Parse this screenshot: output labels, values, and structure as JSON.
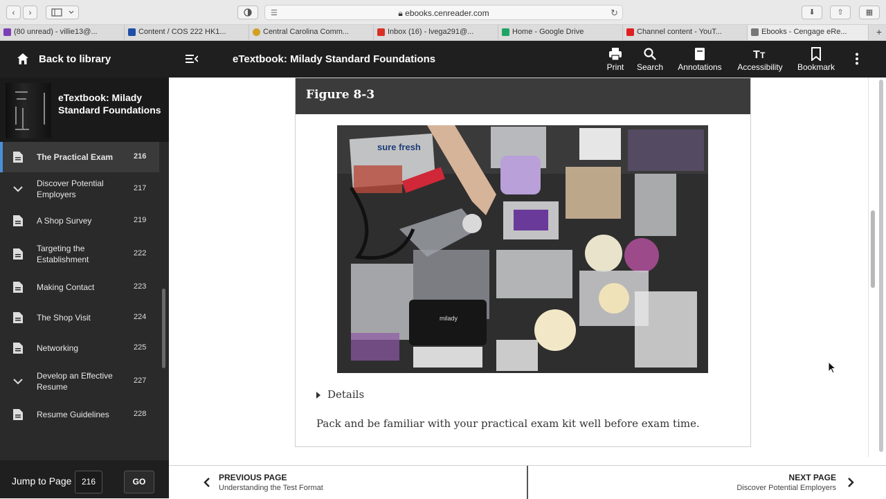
{
  "browser": {
    "url": "ebooks.cenreader.com",
    "tabs": [
      {
        "label": "(80 unread) - villie13@...",
        "color": "#7b3fb5"
      },
      {
        "label": "Content / COS 222 HK1...",
        "color": "#1f4fa8"
      },
      {
        "label": "Central Carolina Comm...",
        "color": "#d0a020"
      },
      {
        "label": "Inbox (16) - lvega291@...",
        "color": "#d93025"
      },
      {
        "label": "Home - Google Drive",
        "color": "#1fa463"
      },
      {
        "label": "Channel content - YouT...",
        "color": "#e02020"
      },
      {
        "label": "Ebooks - Cengage eRe...",
        "color": "#777777"
      }
    ]
  },
  "header": {
    "back_label": "Back to library",
    "title": "eTextbook: Milady Standard Foundations",
    "tools": {
      "print": "Print",
      "search": "Search",
      "annotations": "Annotations",
      "accessibility": "Accessibility",
      "bookmark": "Bookmark"
    }
  },
  "sidebar": {
    "book_title": "eTextbook: Milady Standard Foundations",
    "items": [
      {
        "label": "The Practical Exam",
        "page": "216",
        "icon": "document-icon",
        "active": true
      },
      {
        "label": "Discover Potential Employers",
        "page": "217",
        "icon": "chevron-down-icon",
        "active": false
      },
      {
        "label": "A Shop Survey",
        "page": "219",
        "icon": "document-icon",
        "active": false
      },
      {
        "label": "Targeting the Establishment",
        "page": "222",
        "icon": "document-icon",
        "active": false
      },
      {
        "label": "Making Contact",
        "page": "223",
        "icon": "document-icon",
        "active": false
      },
      {
        "label": "The Shop Visit",
        "page": "224",
        "icon": "document-icon",
        "active": false
      },
      {
        "label": "Networking",
        "page": "225",
        "icon": "document-icon",
        "active": false
      },
      {
        "label": "Develop an Effective Resume",
        "page": "227",
        "icon": "chevron-down-icon",
        "active": false
      },
      {
        "label": "Resume Guidelines",
        "page": "228",
        "icon": "document-icon",
        "active": false
      }
    ],
    "jump_label": "Jump to Page",
    "jump_value": "216",
    "go_label": "GO"
  },
  "content": {
    "figure_title": "Figure  8-3",
    "details_label": "Details",
    "caption": "Pack and be familiar with your practical exam kit well before exam time.",
    "photo_text": "sure fresh",
    "kit_brand": "milady"
  },
  "footer": {
    "prev_label": "PREVIOUS PAGE",
    "prev_title": "Understanding the Test Format",
    "next_label": "NEXT PAGE",
    "next_title": "Discover Potential Employers"
  }
}
